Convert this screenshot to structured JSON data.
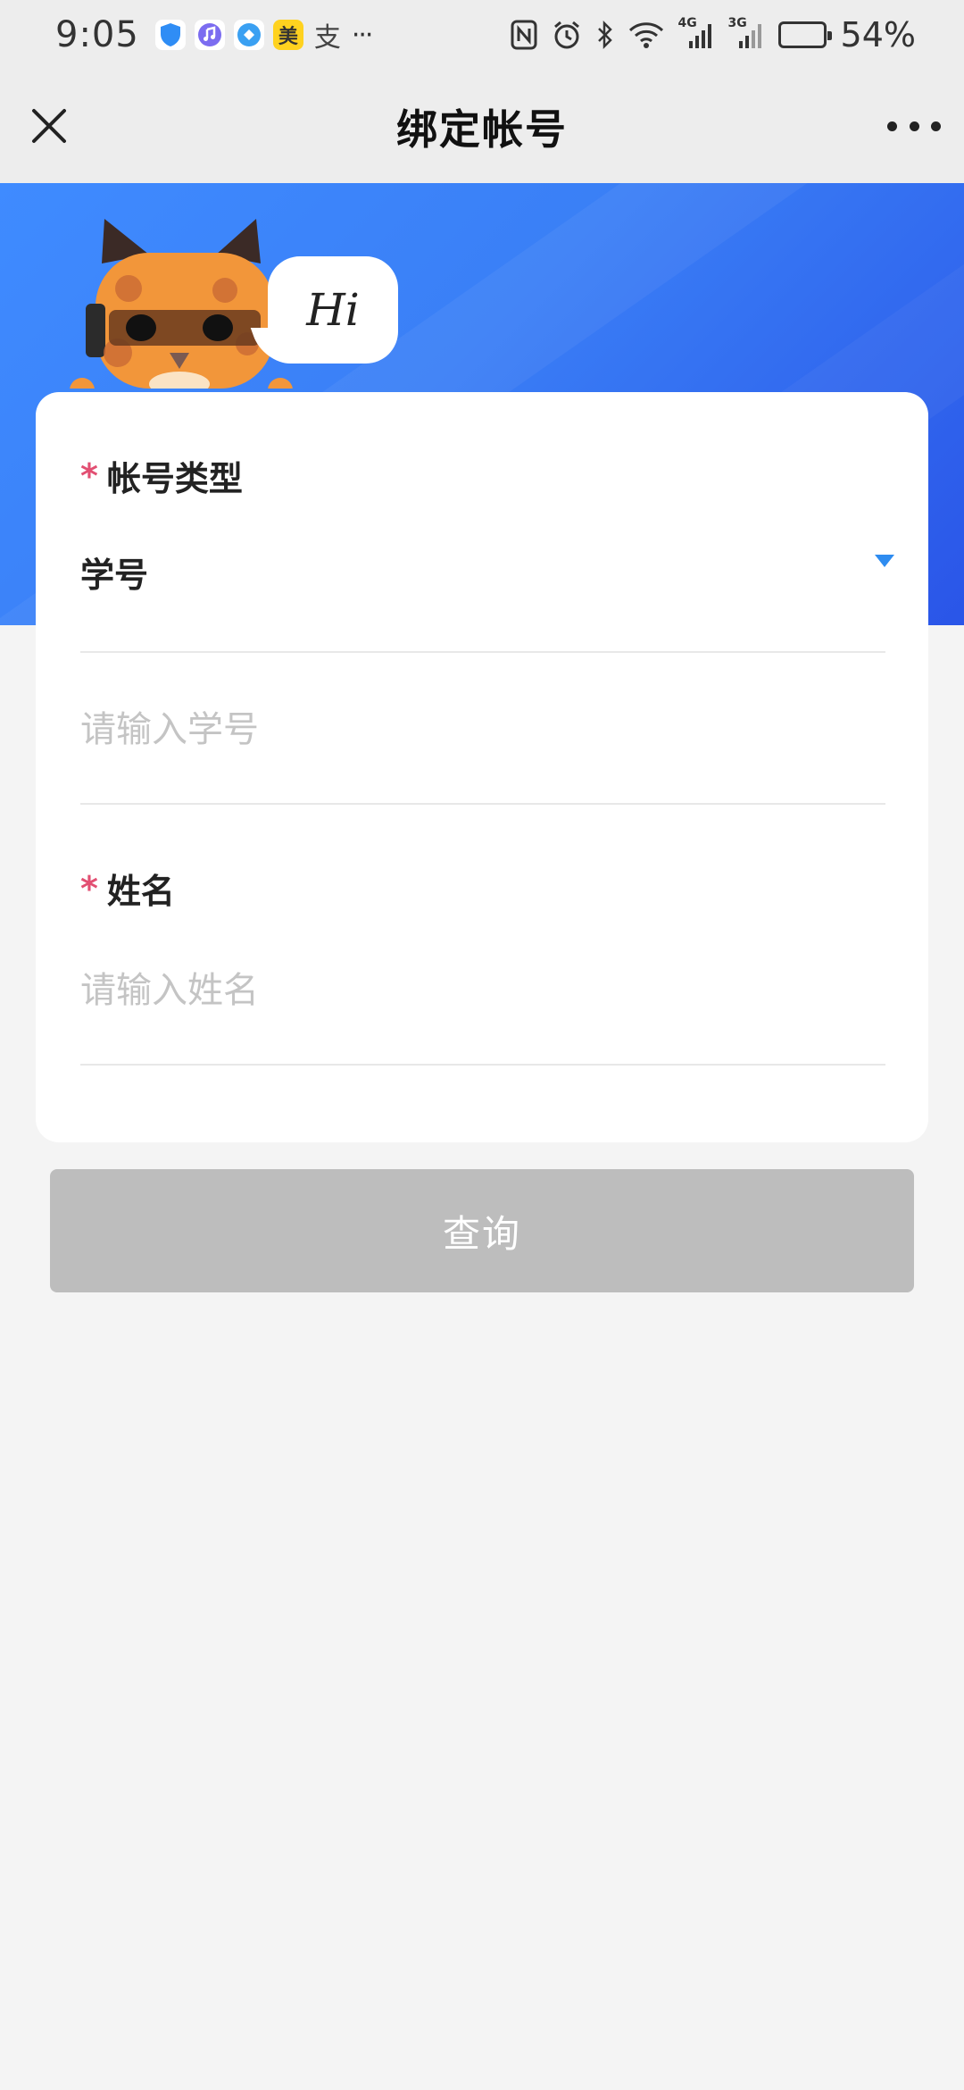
{
  "status_bar": {
    "time": "9:05",
    "app_icons": [
      "shield-icon",
      "music-icon",
      "vpn-icon",
      "meituan-icon",
      "alipay-icon"
    ],
    "meituan_char": "美",
    "alipay_char": "支",
    "overflow": "···",
    "network_4g": "4G",
    "network_3g": "3G",
    "battery_percent": "54%",
    "battery_level": 0.54
  },
  "nav": {
    "title": "绑定帐号"
  },
  "banner": {
    "greeting": "Hi"
  },
  "form": {
    "account_type": {
      "required_mark": "*",
      "label": "帐号类型",
      "selected": "学号"
    },
    "student_id": {
      "placeholder": "请输入学号"
    },
    "name": {
      "required_mark": "*",
      "label": "姓名",
      "placeholder": "请输入姓名"
    }
  },
  "actions": {
    "query_label": "查询"
  },
  "colors": {
    "banner_blue": "#3a7ff6",
    "required_red": "#e24f72",
    "arrow_blue": "#2e8cf0",
    "button_disabled": "#bdbdbd",
    "page_bg": "#f4f4f4"
  }
}
